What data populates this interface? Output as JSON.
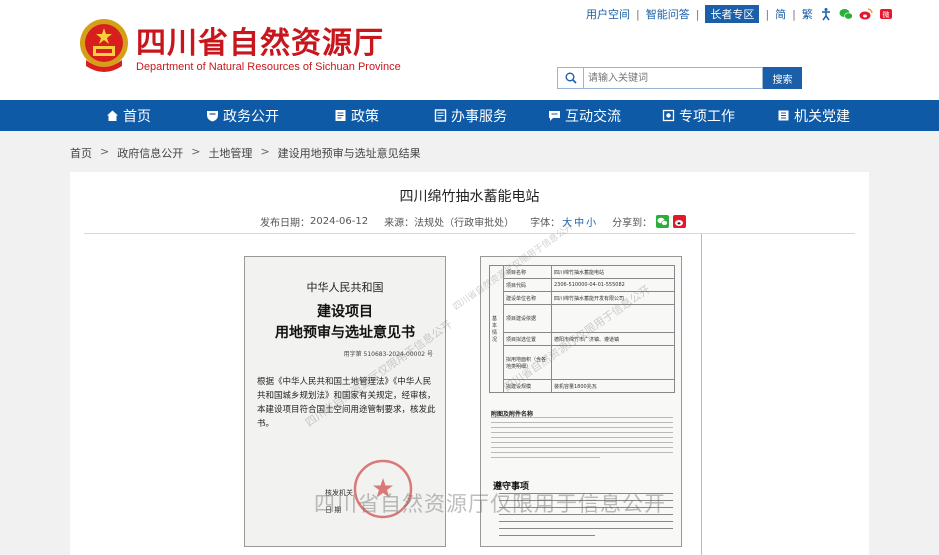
{
  "header": {
    "site_name_cn": "四川省自然资源厅",
    "site_name_en": "Department of Natural Resources of Sichuan Province",
    "top_links": {
      "user_space": "用户空间",
      "smart_qa": "智能问答",
      "elder_zone": "长者专区",
      "simplified": "简",
      "traditional": "繁"
    },
    "search": {
      "placeholder": "请输入关键词",
      "button": "搜索"
    }
  },
  "nav": {
    "items": [
      {
        "label": "首页",
        "icon": "home-icon"
      },
      {
        "label": "政务公开",
        "icon": "shield-icon"
      },
      {
        "label": "政策",
        "icon": "document-icon"
      },
      {
        "label": "办事服务",
        "icon": "form-icon"
      },
      {
        "label": "互动交流",
        "icon": "chat-icon"
      },
      {
        "label": "专项工作",
        "icon": "target-icon"
      },
      {
        "label": "机关党建",
        "icon": "book-icon"
      }
    ]
  },
  "breadcrumb": [
    "首页",
    "政府信息公开",
    "土地管理",
    "建设用地预审与选址意见结果"
  ],
  "article": {
    "title": "四川绵竹抽水蓄能电站",
    "publish_label": "发布日期：",
    "publish_date": "2024-06-12",
    "source_label": "来源：",
    "source": "法规处（行政审批处）",
    "font_label": "字体：",
    "font_large": "大",
    "font_medium": "中",
    "font_small": "小",
    "share_label": "分享到："
  },
  "doc1": {
    "country": "中华人民共和国",
    "title_line1": "建设项目",
    "title_line2": "用地预审与选址意见书",
    "number": "用字第 510683-2024-00002 号",
    "body": "根据《中华人民共和国土地管理法》《中华人民共和国城乡规划法》和国家有关规定，经审核，本建设项目符合国土空间用途管制要求，核发此书。",
    "issuer_label": "核发机关",
    "date_label": "日  期",
    "seal_text": "四川省自然资源厅"
  },
  "doc2": {
    "side_label": "基本情况",
    "rows": [
      {
        "k": "项目名称",
        "v": "四川绵竹抽水蓄能电站"
      },
      {
        "k": "项目代码",
        "v": "2306-510000-04-01-555082"
      },
      {
        "k": "建设单位名称",
        "v": "四川绵竹抽水蓄能开发有限公司"
      },
      {
        "k": "项目建设依据",
        "v": ""
      },
      {
        "k": "项目拟选位置",
        "v": "德阳市绵竹市广济镇、遵道镇"
      },
      {
        "k": "拟用地面积（含各地类明细）",
        "v": ""
      },
      {
        "k": "拟建设规模",
        "v": "装机容量1800兆瓦"
      }
    ],
    "note_title": "附图及附件名称",
    "notice_title": "遵守事项"
  },
  "watermark": "四川省自然资源厅仅限用于信息公开"
}
